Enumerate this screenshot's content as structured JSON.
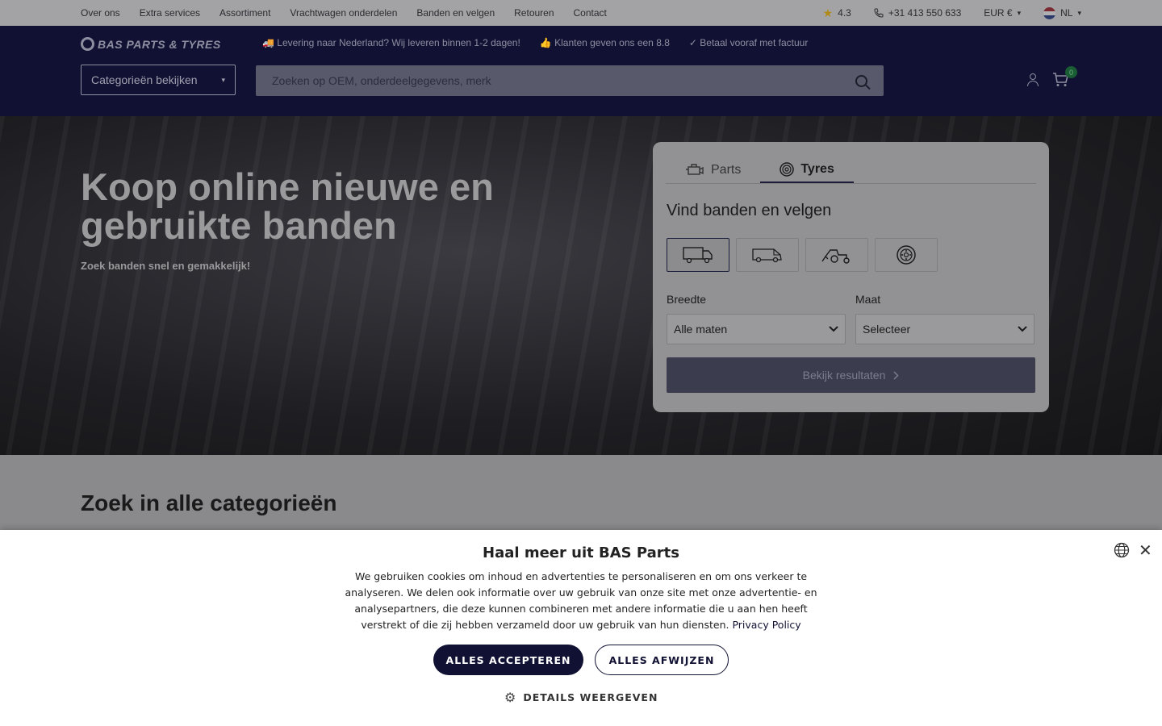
{
  "topbar": {
    "nav": [
      "Over ons",
      "Extra services",
      "Assortiment",
      "Vrachtwagen onderdelen",
      "Banden en velgen",
      "Retouren",
      "Contact"
    ],
    "rating": "4.3",
    "phone": "+31 413 550 633",
    "currency": "EUR €",
    "language": "NL"
  },
  "header": {
    "logo_text": "BAS PARTS & TYRES",
    "usps": [
      "Levering naar Nederland? Wij leveren binnen 1-2 dagen!",
      "Klanten geven ons een 8.8",
      "Betaal vooraf met factuur"
    ],
    "category_button": "Categorieën bekijken",
    "search_placeholder": "Zoeken op OEM, onderdeelgegevens, merk",
    "cart_count": "0"
  },
  "hero": {
    "title": "Koop online nieuwe en gebruikte banden",
    "subtitle": "Zoek banden snel en gemakkelijk!"
  },
  "finder": {
    "tabs": [
      "Parts",
      "Tyres"
    ],
    "active_tab": "Tyres",
    "title": "Vind banden en velgen",
    "vehicle_types": [
      "truck-icon",
      "van-icon",
      "tractor-icon",
      "wheel-icon"
    ],
    "width_label": "Breedte",
    "width_value": "Alle maten",
    "size_label": "Maat",
    "size_value": "Selecteer",
    "results_button": "Bekijk resultaten"
  },
  "categories": {
    "title": "Zoek in alle categorieën"
  },
  "cookie": {
    "title": "Haal meer uit BAS Parts",
    "text": "We gebruiken cookies om inhoud en advertenties te personaliseren en om ons verkeer te analyseren. We delen ook informatie over uw gebruik van onze site met onze advertentie- en analysepartners, die deze kunnen combineren met andere informatie die u aan hen heeft verstrekt of die zij hebben verzameld door uw gebruik van hun diensten.",
    "policy_link": "Privacy Policy",
    "accept": "ALLES ACCEPTEREN",
    "reject": "ALLES AFWIJZEN",
    "details": "DETAILS WEERGEVEN"
  }
}
